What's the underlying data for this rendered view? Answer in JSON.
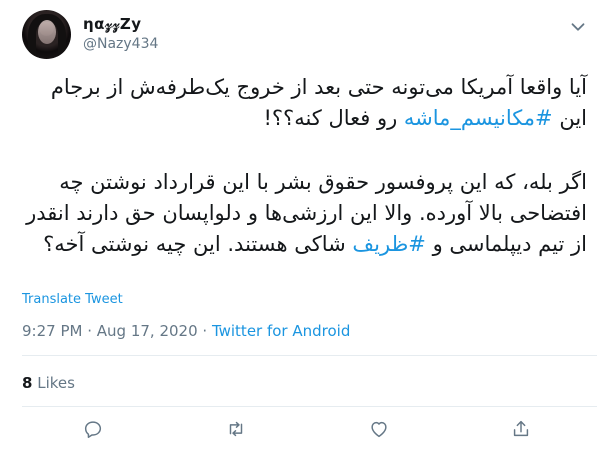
{
  "user": {
    "display_name": "ηα𝓏𝓏Zy",
    "handle": "@Nazy434"
  },
  "tweet": {
    "paragraph1_part1": "آیا واقعا آمریکا می‌تونه حتی بعد از خروج یک‌طرفه‌ش از برجام این ",
    "hashtag1": "#مکانیسم_ماشه",
    "paragraph1_part2": " رو فعال کنه؟؟!",
    "paragraph2_part1": "اگر بله، که این پروفسور حقوق بشر با این قرارداد نوشتن چه افتضاحی بالا آورده. والا این ارزشی‌ها و دلواپسان حق دارند انقدر از تیم دیپلماسی و ",
    "hashtag2": "#ظریف",
    "paragraph2_part2": " شاکی هستند. این چیه نوشتی آخه؟"
  },
  "translate_label": "Translate Tweet",
  "meta": {
    "time": "9:27 PM",
    "separator": " · ",
    "date": "Aug 17, 2020",
    "source": "Twitter for Android"
  },
  "stats": {
    "likes_count": "8",
    "likes_label": "Likes"
  },
  "icons": [
    "chevron-down-icon",
    "reply-icon",
    "retweet-icon",
    "like-icon",
    "share-icon"
  ],
  "colors": {
    "link": "#1b95e0",
    "secondary_text": "#657786",
    "divider": "#e6ecf0"
  }
}
